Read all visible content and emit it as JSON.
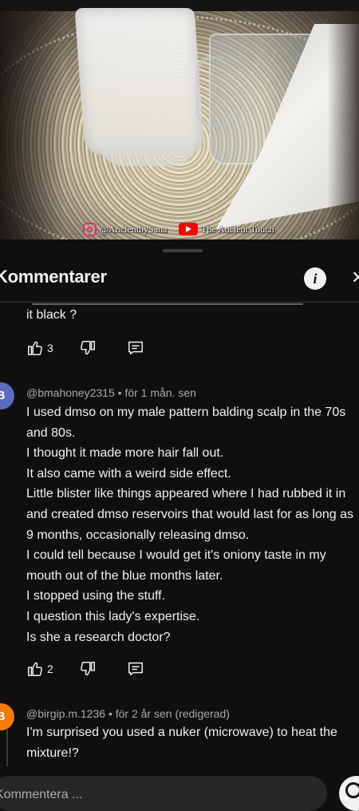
{
  "video": {
    "watermark_instagram": "@AncientbySana",
    "watermark_youtube": "The Ancient Touch"
  },
  "panel": {
    "title": "Kommentarer",
    "info_icon": "info-icon",
    "close_icon": "close-icon"
  },
  "comments": [
    {
      "text": "it black ?",
      "likes": "3",
      "icons": [
        "thumbs-up-icon",
        "thumbs-down-icon",
        "reply-icon"
      ]
    },
    {
      "avatar_letter": "B",
      "avatar_color": "#5c6bc0",
      "author": "@bmahoney2315",
      "separator": "•",
      "time": "för 1 mån. sen",
      "text": "I used dmso on my male pattern balding scalp in the 70s and 80s.\nI thought  it made more hair fall out.\nIt also came with a weird  side effect.\nLittle blister like things appeared where I had rubbed it in and created dmso reservoirs that would last for as long as 9 months, occasionally  releasing dmso.\nI could tell because I  would get it's  oniony taste in my mouth  out of the blue months later.\nI stopped using the stuff.\nI question this lady's  expertise.\nIs she a research doctor?",
      "likes": "2"
    },
    {
      "avatar_letter": "B",
      "avatar_color": "#f57c00",
      "author": "@birgip.m.1236",
      "separator": "•",
      "time": "för 2 år sen (redigerad)",
      "text": "I'm surprised you used a nuker (microwave) to heat the mixture!?"
    }
  ],
  "composer": {
    "placeholder": "Kommentera ..."
  },
  "colors": {
    "background": "#0f0f0f",
    "text": "#f1f1f1",
    "secondary_text": "#aaaaaa"
  }
}
